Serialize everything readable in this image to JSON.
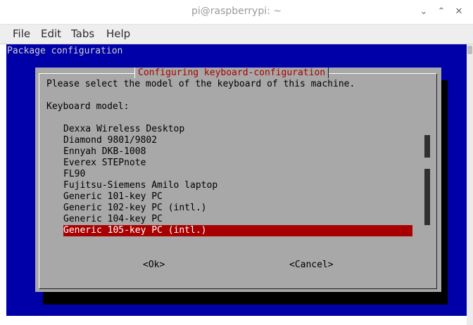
{
  "window": {
    "title": "pi@raspberrypi: ~",
    "controls": [
      "⌄",
      "⌃",
      "✕"
    ]
  },
  "menu": [
    "File",
    "Edit",
    "Tabs",
    "Help"
  ],
  "terminal": {
    "header": "Package configuration",
    "dialog": {
      "title": "Configuring keyboard-configuration",
      "prompt": "Please select the model of the keyboard of this machine.",
      "label": "Keyboard model:",
      "items": [
        "Dexxa Wireless Desktop",
        "Diamond 9801/9802",
        "Ennyah DKB-1008",
        "Everex STEPnote",
        "FL90",
        "Fujitsu-Siemens Amilo laptop",
        "Generic 101-key PC",
        "Generic 102-key PC (intl.)",
        "Generic 104-key PC",
        "Generic 105-key PC (intl.)"
      ],
      "selected_index": 9,
      "ok_label": "<Ok>",
      "cancel_label": "<Cancel>"
    }
  },
  "colors": {
    "terminal_bg": "#0000a8",
    "dialog_bg": "#a8a8a8",
    "title_red": "#a80000",
    "selection_bg": "#a80000"
  }
}
